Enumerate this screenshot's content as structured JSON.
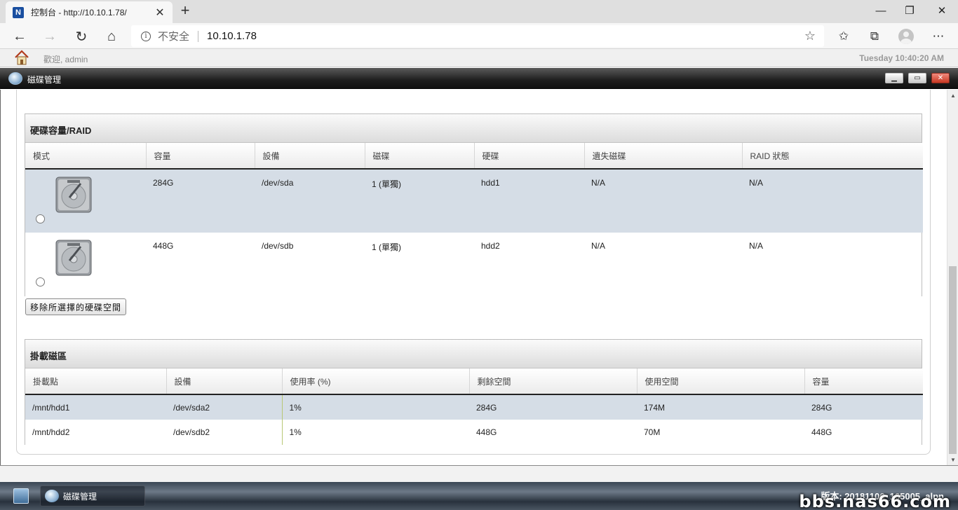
{
  "browser": {
    "tab_title": "控制台 - http://10.10.1.78/",
    "favicon_letter": "N",
    "insecure_label": "不安全",
    "url": "10.10.1.78"
  },
  "header": {
    "welcome": "歡迎, admin",
    "clock": "Tuesday 10:40:20 AM"
  },
  "window": {
    "title": "磁碟管理"
  },
  "raid_section": {
    "title": "硬碟容量/RAID",
    "columns": [
      "模式",
      "容量",
      "設備",
      "磁碟",
      "硬碟",
      "遺失磁碟",
      "RAID 狀態"
    ],
    "rows": [
      {
        "capacity": "284G",
        "device": "/dev/sda",
        "disk": "1 (單獨)",
        "hdd": "hdd1",
        "missing": "N/A",
        "raid_status": "N/A",
        "selected": true
      },
      {
        "capacity": "448G",
        "device": "/dev/sdb",
        "disk": "1 (單獨)",
        "hdd": "hdd2",
        "missing": "N/A",
        "raid_status": "N/A",
        "selected": false
      }
    ],
    "remove_button": "移除所選擇的硬碟空間"
  },
  "mount_section": {
    "title": "掛載磁區",
    "columns": [
      "掛載點",
      "設備",
      "使用率 (%)",
      "剩餘空間",
      "使用空間",
      "容量"
    ],
    "rows": [
      {
        "mount": "/mnt/hdd1",
        "device": "/dev/sda2",
        "usage": "1%",
        "free": "284G",
        "used": "174M",
        "capacity": "284G",
        "selected": true
      },
      {
        "mount": "/mnt/hdd2",
        "device": "/dev/sdb2",
        "usage": "1%",
        "free": "448G",
        "used": "70M",
        "capacity": "448G",
        "selected": false
      }
    ]
  },
  "taskbar": {
    "item_label": "磁碟管理",
    "version": "版本: 20181106_165005_alpn",
    "watermark": "bbs.nas66.com"
  },
  "colors": {
    "selected_row": "#d5dde6",
    "titlebar": "#1e1e1e",
    "close_button": "#c83822"
  },
  "icons": [
    "home-icon",
    "info-icon",
    "star-icon",
    "hdd-icon",
    "minimize-icon",
    "restore-icon",
    "close-icon"
  ]
}
